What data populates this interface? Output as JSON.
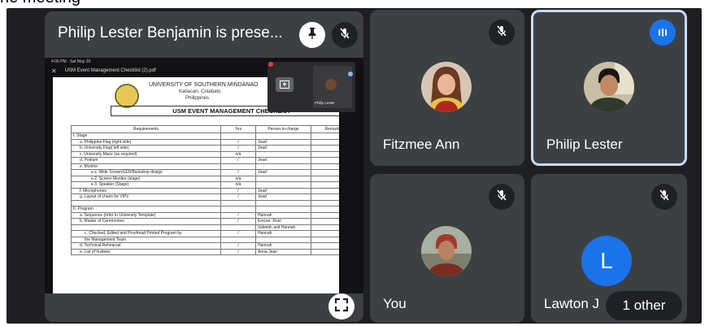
{
  "window": {
    "top_cut_text": "he meeting"
  },
  "presentation": {
    "title": "Philip Lester Benjamin is prese...",
    "phone_status": "4:06 PM · Sat May 20",
    "file_name": "USM Event Management Checklist (2).pdf",
    "pip_name": "Philip Lester",
    "document": {
      "university": "UNIVERSITY OF SOUTHERN MINDANAO",
      "location": "Kabacan, Cotabato",
      "country": "Philippines",
      "heading": "USM EVENT MANAGEMENT CHECKLIST",
      "columns": [
        "Requirements",
        "Yes",
        "Person-in-charge",
        "Remarks"
      ],
      "rows": [
        {
          "req": "I. Stage",
          "yes": "",
          "person": "",
          "level": 0
        },
        {
          "req": "a. Philippine Flag (right side)",
          "yes": "/",
          "person": "Jead",
          "level": 1
        },
        {
          "req": "b. University Flag( left side)",
          "yes": "/",
          "person": "Jead",
          "level": 1
        },
        {
          "req": "c. University Mace (as required)",
          "yes": "n/a",
          "person": "",
          "level": 1
        },
        {
          "req": "d. Podium",
          "yes": "/",
          "person": "Jead",
          "level": 1
        },
        {
          "req": "e. Monitor",
          "yes": "",
          "person": "",
          "level": 1
        },
        {
          "req": "e.s. Wide Screen/LED/Backdrop design",
          "yes": "/",
          "person": "Jead",
          "level": 3
        },
        {
          "req": "e.2. Screen Monitor (stage)",
          "yes": "n/a",
          "person": "",
          "level": 3
        },
        {
          "req": "e.3. Speaker (Stage)",
          "yes": "n/a",
          "person": "",
          "level": 3
        },
        {
          "req": "f. Microphones",
          "yes": "/",
          "person": "Jead",
          "level": 1
        },
        {
          "req": "g. Layout of chairs for VIPs",
          "yes": "/",
          "person": "Jead",
          "level": 1
        },
        {
          "req": "",
          "yes": "",
          "person": "",
          "level": 0
        },
        {
          "req": "II. Program",
          "yes": "",
          "person": "",
          "level": 0
        },
        {
          "req": "a. Sequence (refer to University Template)",
          "yes": "/",
          "person": "Hannah",
          "level": 1
        },
        {
          "req": "b. Master of Ceremonies",
          "yes": "/",
          "person": "Emcee: Roel",
          "level": 1
        },
        {
          "req": "",
          "yes": "",
          "person": "Valentin and Hannah",
          "level": 1
        },
        {
          "req": "c. Checked, Edited and Proofread Printed Program by",
          "yes": "/",
          "person": "Hannah",
          "level": 2
        },
        {
          "req": "the Management Team",
          "yes": "",
          "person": "",
          "level": 2
        },
        {
          "req": "d. Technical Rehearsal",
          "yes": "/",
          "person": "Hannah",
          "level": 1
        },
        {
          "req": "e. List of Invitees",
          "yes": "/",
          "person": "Anna Jean",
          "level": 1
        }
      ]
    }
  },
  "participants": [
    {
      "name": "Fitzmee Ann",
      "muted": true
    },
    {
      "name": "Philip Lester",
      "speaking": true
    },
    {
      "name": "You",
      "muted": true
    },
    {
      "name": "Lawton J",
      "initial": "L",
      "muted": true,
      "others_label": "1 other"
    }
  ],
  "colors": {
    "background": "#1f1f22",
    "tile": "#3c4043",
    "active_border": "#c7dafc",
    "speaking_badge": "#1a73e8",
    "avatar_letter_bg": "#1a73e8"
  }
}
